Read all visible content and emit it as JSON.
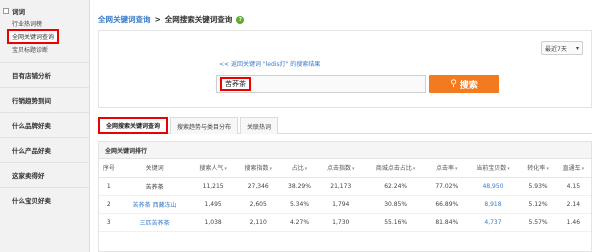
{
  "sidebar": {
    "head": "词词",
    "subs": [
      {
        "label": "行业热词榜",
        "active": false
      },
      {
        "label": "全网关键词查询",
        "active": true
      },
      {
        "label": "宝贝标题诊断",
        "active": false
      }
    ],
    "sections": [
      "目有店铺分析",
      "行销趋势到间",
      "什么品牌好卖",
      "什么产品好卖",
      "这家卖得好",
      "什么宝贝好卖"
    ]
  },
  "breadcrumb": {
    "link": "全网关键词查询",
    "sep": ">",
    "current": "全网搜索关键词查询",
    "help": "?"
  },
  "search": {
    "period": "最近7天",
    "hint": "<< 返回关键词 \"ledis灯\" 的搜索结果",
    "value": "苦荞茶",
    "button": "搜索"
  },
  "tabs": [
    {
      "label": "全网搜索关键词查询",
      "active": true
    },
    {
      "label": "搜索趋势与类目分布",
      "active": false
    },
    {
      "label": "关联热词",
      "active": false
    }
  ],
  "table": {
    "title": "全网关键词排行",
    "columns": [
      "序号",
      "关键词",
      "搜索人气",
      "搜索指数",
      "占比",
      "点击指数",
      "商城点击占比",
      "点击率",
      "当前宝贝数",
      "转化率",
      "直通车"
    ],
    "rows": [
      [
        "1",
        "苦荞茶",
        "11,215",
        "27,346",
        "38.29%",
        "21,173",
        "62.24%",
        "77.02%",
        "48,950",
        "5.93%",
        "4.15"
      ],
      [
        "2",
        "苦荞茶 西藏冻山",
        "1,495",
        "2,605",
        "5.34%",
        "1,794",
        "30.85%",
        "66.89%",
        "8,918",
        "5.12%",
        "2.14"
      ],
      [
        "3",
        "三匹苦荞茶",
        "1,038",
        "2,110",
        "4.27%",
        "1,730",
        "55.16%",
        "81.84%",
        "4,737",
        "5.57%",
        "1.46"
      ]
    ]
  },
  "colors": {
    "accent": "#f37a1f",
    "link": "#3a7bc8",
    "highlight": "#e00000",
    "help": "#5fa832"
  }
}
